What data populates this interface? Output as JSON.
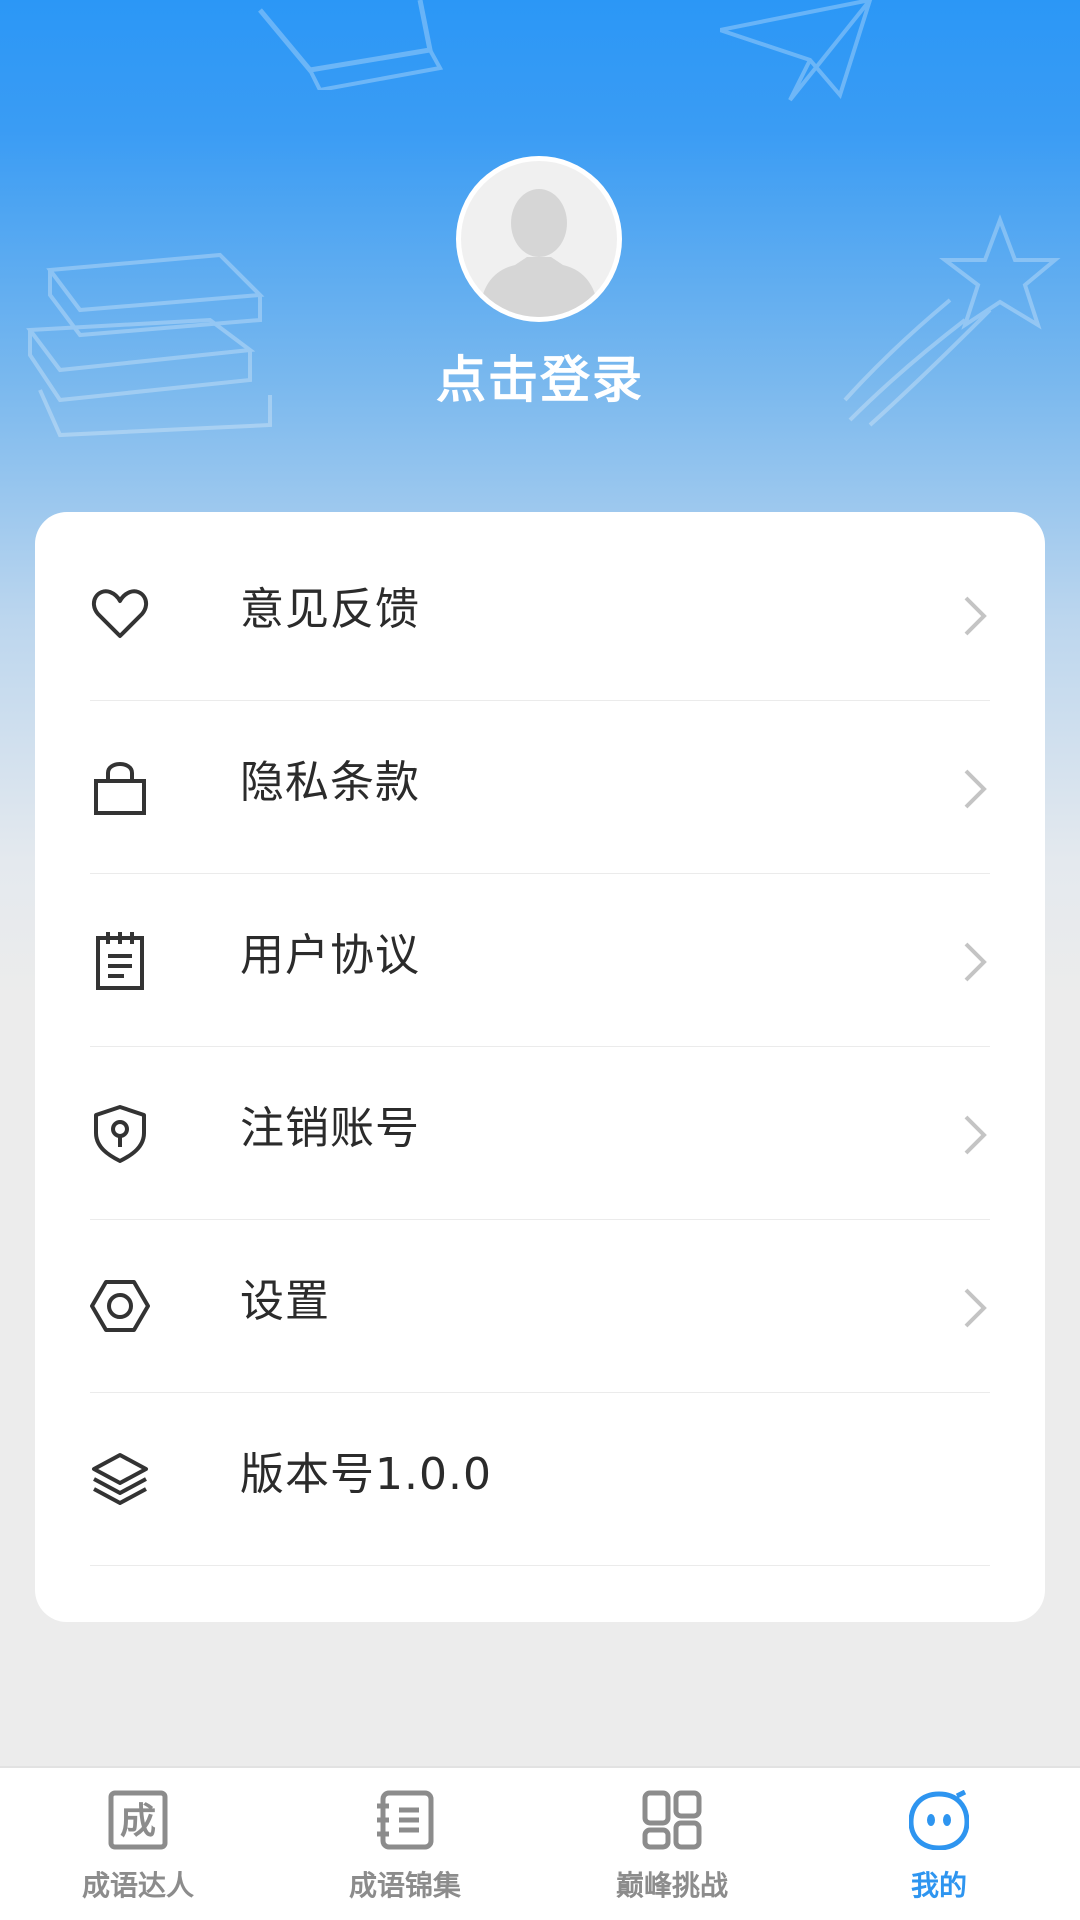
{
  "colors": {
    "accent": "#2e95f0",
    "header_top": "#2b97f6",
    "icon_gray": "#8c8c8c",
    "text": "#2b2b2b"
  },
  "profile": {
    "avatar_icon": "default-avatar-icon",
    "login_label": "点击登录"
  },
  "menu": [
    {
      "id": "feedback",
      "label": "意见反馈",
      "icon": "heart-icon",
      "chevron": true
    },
    {
      "id": "privacy",
      "label": "隐私条款",
      "icon": "bag-icon",
      "chevron": true
    },
    {
      "id": "agreement",
      "label": "用户协议",
      "icon": "notepad-icon",
      "chevron": true
    },
    {
      "id": "deactivate",
      "label": "注销账号",
      "icon": "shield-lock-icon",
      "chevron": true
    },
    {
      "id": "settings",
      "label": "设置",
      "icon": "hexagon-gear-icon",
      "chevron": true
    },
    {
      "id": "version",
      "label": "版本号1.0.0",
      "icon": "layers-icon",
      "chevron": false
    }
  ],
  "tabs": [
    {
      "label": "成语达人",
      "icon": "cheng-box-icon",
      "active": false
    },
    {
      "label": "成语锦集",
      "icon": "notebook-icon",
      "active": false
    },
    {
      "label": "巅峰挑战",
      "icon": "grid-icon",
      "active": false
    },
    {
      "label": "我的",
      "icon": "robot-face-icon",
      "active": true
    }
  ],
  "tab_icon_text": {
    "cheng": "成"
  }
}
